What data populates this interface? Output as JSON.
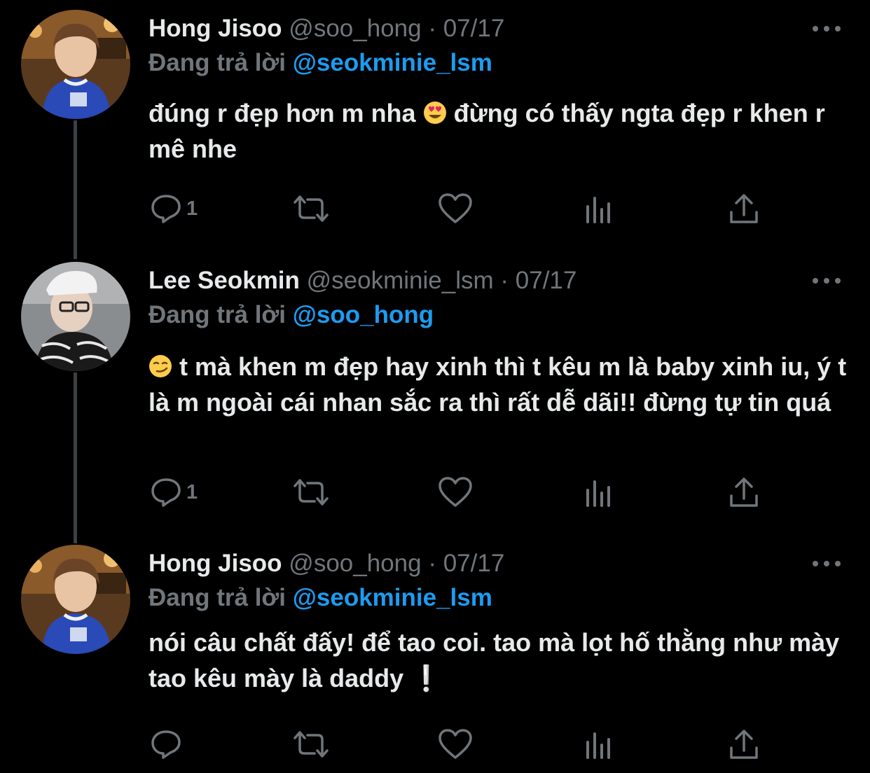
{
  "tweets": [
    {
      "display_name": "Hong Jisoo",
      "handle": "@soo_hong",
      "separator": "·",
      "date": "07/17",
      "reply_prefix": "Đang trả lời",
      "reply_to": "@seokminie_lsm",
      "text_before_emoji": "đúng r đẹp hơn m nha",
      "emoji": "smiling-face-with-heart-eyes",
      "text_after_emoji": "đừng có thấy ngta đẹp r khen r mê nhe",
      "reply_count": "1"
    },
    {
      "display_name": "Lee Seokmin",
      "handle": "@seokminie_lsm",
      "separator": "·",
      "date": "07/17",
      "reply_prefix": "Đang trả lời",
      "reply_to": "@soo_hong",
      "emoji": "smirking-face",
      "text_after_emoji": "t mà khen m đẹp hay xinh thì t kêu m là baby xinh iu, ý t là m ngoài cái nhan sắc ra thì rất dễ dãi!! đừng tự tin quá",
      "reply_count": "1"
    },
    {
      "display_name": "Hong Jisoo",
      "handle": "@soo_hong",
      "separator": "·",
      "date": "07/17",
      "reply_prefix": "Đang trả lời",
      "reply_to": "@seokminie_lsm",
      "text": "nói câu chất đấy! để tao coi. tao mà lọt hố thằng như mày tao kêu mày là daddy ❕",
      "reply_count": ""
    }
  ],
  "icons": {
    "reply": "reply-icon",
    "retweet": "retweet-icon",
    "like": "heart-icon",
    "analytics": "analytics-icon",
    "share": "share-icon",
    "more": "more-icon"
  },
  "colors": {
    "background": "#000000",
    "text": "#e7e9ea",
    "secondary": "#71767b",
    "link": "#1d9bf0",
    "thread_line": "#3e4144"
  }
}
